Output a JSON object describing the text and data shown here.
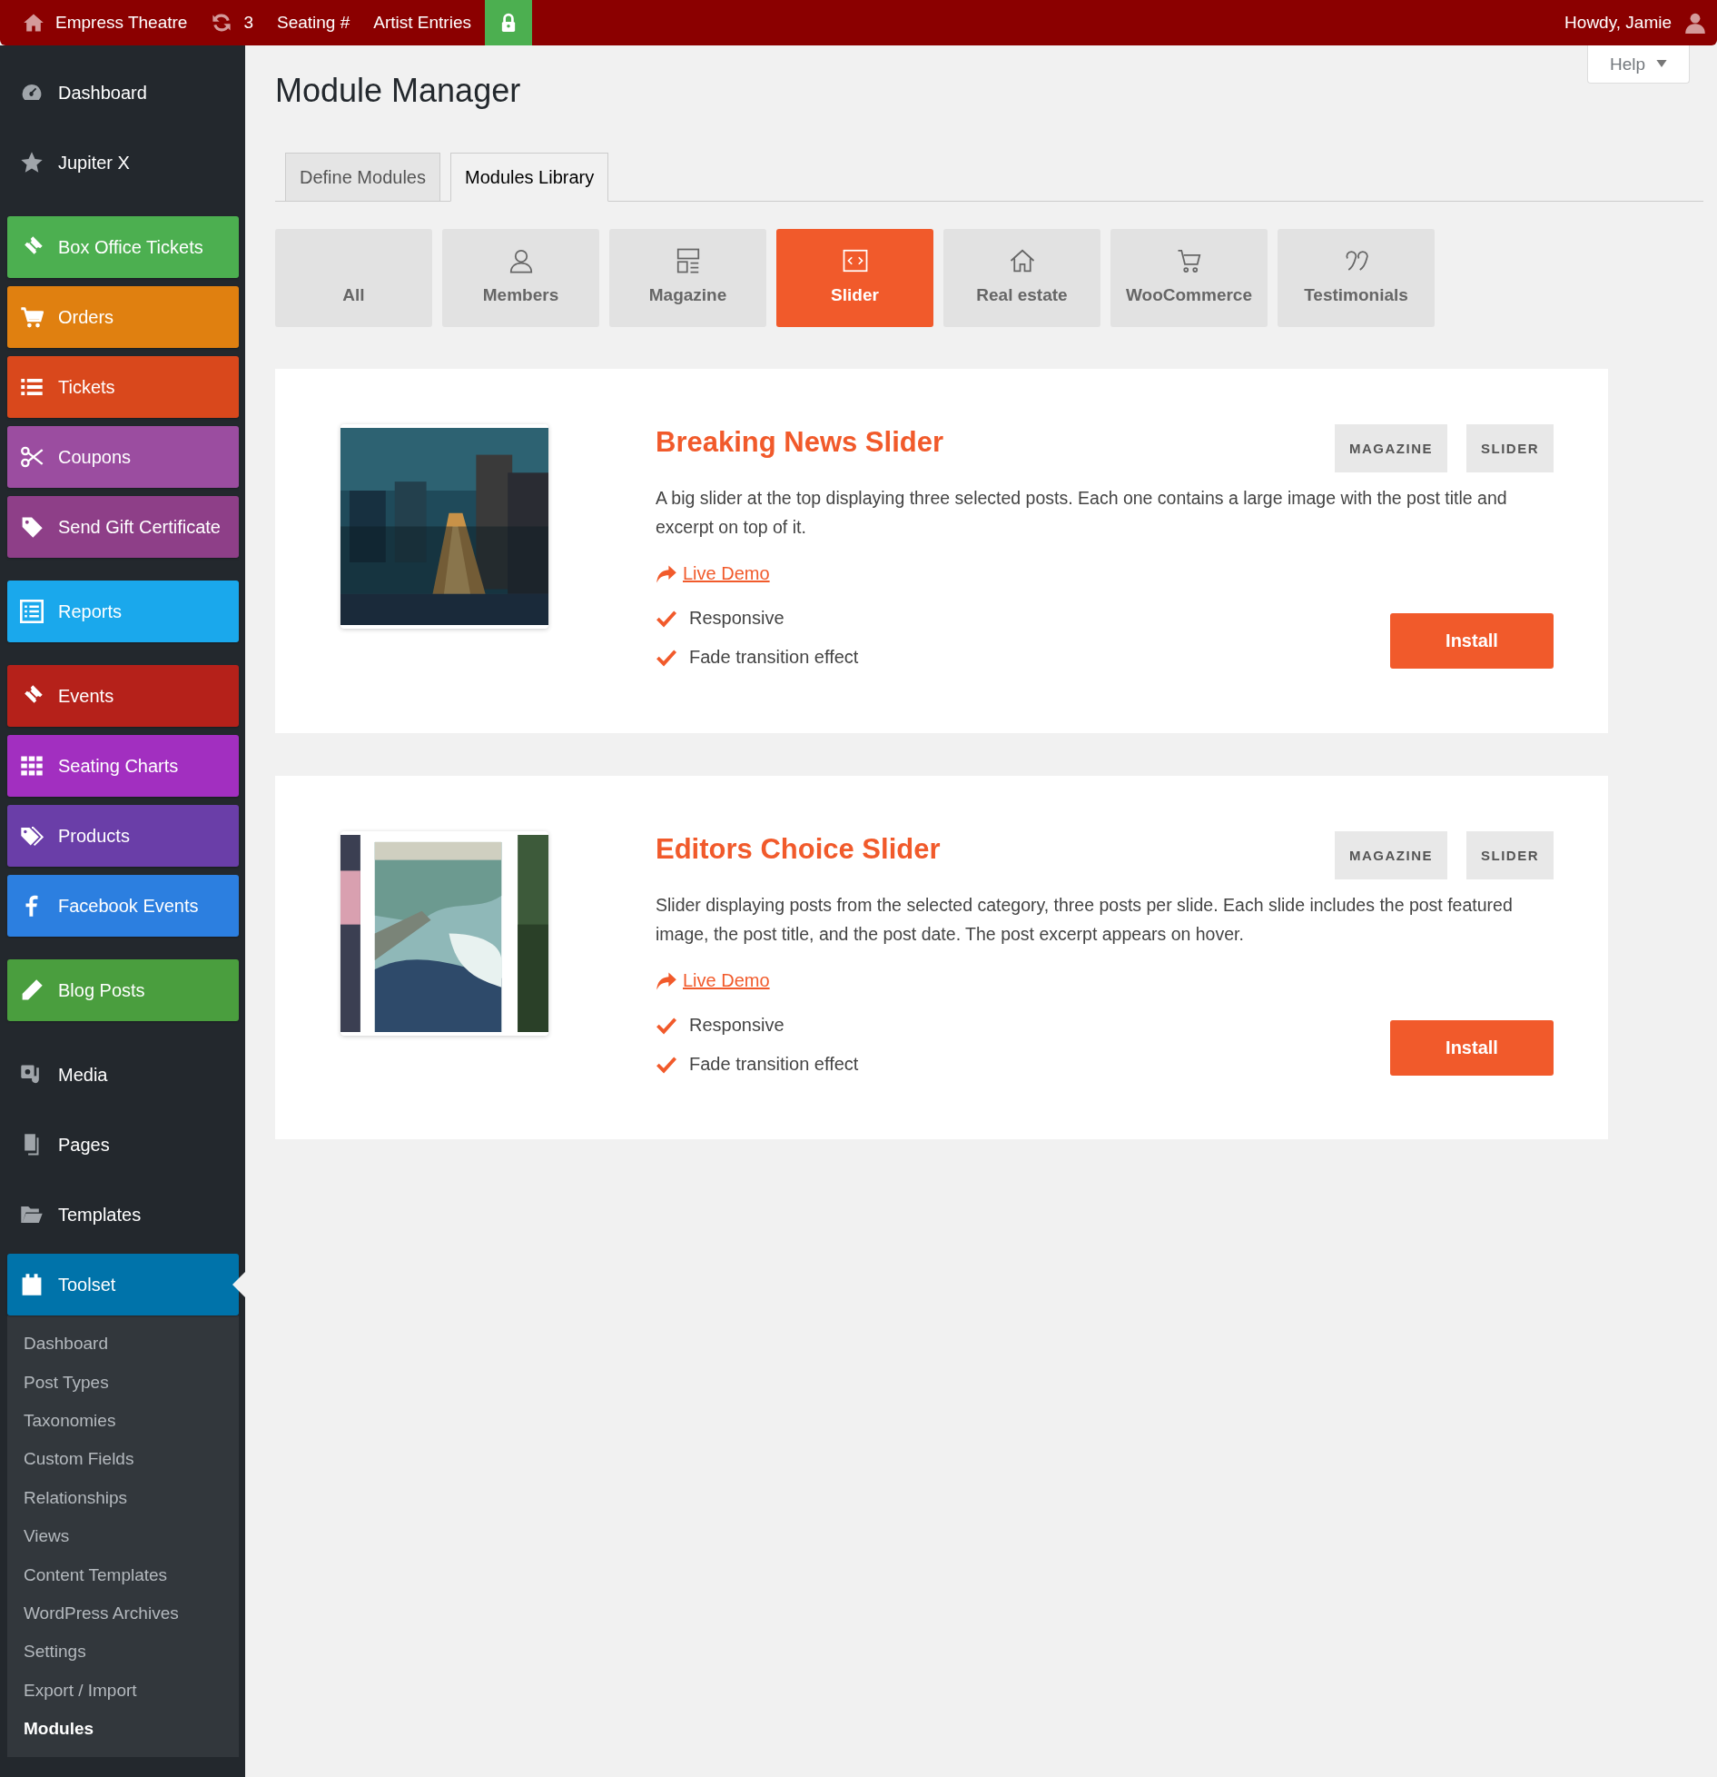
{
  "admin_bar": {
    "items": [
      {
        "kind": "home",
        "label": "Empress Theatre"
      },
      {
        "kind": "updates",
        "label": "3"
      },
      {
        "kind": "text",
        "label": "Seating #"
      },
      {
        "kind": "text",
        "label": "Artist Entries"
      },
      {
        "kind": "lock"
      }
    ],
    "account": "Howdy, Jamie"
  },
  "sidebar": {
    "groups": [
      [
        {
          "label": "Dashboard",
          "selected": false
        },
        {
          "label": "Jupiter X",
          "selected": false
        }
      ],
      [
        {
          "label": "Box Office Tickets",
          "color": "#4caf50",
          "selected": false
        },
        {
          "label": "Orders",
          "color": "#e08010",
          "selected": false
        },
        {
          "label": "Tickets",
          "color": "#d9481c",
          "selected": false
        },
        {
          "label": "Coupons",
          "color": "#9b4da0",
          "selected": false
        },
        {
          "label": "Send Gift Certificate",
          "color": "#8e3f88",
          "selected": false
        }
      ],
      [
        {
          "label": "Reports",
          "color": "#1aa8ec",
          "selected": false
        }
      ],
      [
        {
          "label": "Events",
          "color": "#b5211a",
          "selected": false
        },
        {
          "label": "Seating Charts",
          "color": "#a22fc0",
          "selected": false
        },
        {
          "label": "Products",
          "color": "#6a3ea8",
          "selected": false
        },
        {
          "label": "Facebook Events",
          "color": "#2c7fe0",
          "selected": false
        }
      ],
      [
        {
          "label": "Blog Posts",
          "color": "#4a9e3e",
          "selected": false
        }
      ],
      [
        {
          "label": "Media",
          "selected": false
        },
        {
          "label": "Pages",
          "selected": false
        },
        {
          "label": "Templates",
          "selected": false
        },
        {
          "label": "Toolset",
          "color": "#0073aa",
          "selected": true,
          "children": [
            {
              "label": "Dashboard",
              "selected": false
            },
            {
              "label": "Post Types",
              "selected": false
            },
            {
              "label": "Taxonomies",
              "selected": false
            },
            {
              "label": "Custom Fields",
              "selected": false
            },
            {
              "label": "Relationships",
              "selected": false
            },
            {
              "label": "Views",
              "selected": false
            },
            {
              "label": "Content Templates",
              "selected": false
            },
            {
              "label": "WordPress Archives",
              "selected": false
            },
            {
              "label": "Settings",
              "selected": false
            },
            {
              "label": "Export / Import",
              "selected": false
            },
            {
              "label": "Modules",
              "selected": true
            }
          ]
        }
      ]
    ]
  },
  "help_button": "Help",
  "page_title": "Module Manager",
  "tabs": [
    {
      "label": "Define Modules",
      "selected": false
    },
    {
      "label": "Modules Library",
      "selected": true
    }
  ],
  "filters": [
    {
      "label": "All",
      "selected": false
    },
    {
      "label": "Members",
      "selected": false
    },
    {
      "label": "Magazine",
      "selected": false
    },
    {
      "label": "Slider",
      "selected": true
    },
    {
      "label": "Real estate",
      "selected": false
    },
    {
      "label": "WooCommerce",
      "selected": false
    },
    {
      "label": "Testimonials",
      "selected": false
    }
  ],
  "modules": [
    {
      "title": "Breaking News Slider",
      "tags": [
        "MAGAZINE",
        "SLIDER"
      ],
      "description": "A big slider at the top displaying three selected posts. Each one contains a large image with the post title and excerpt on top of it.",
      "demo_link": "Live Demo",
      "features": [
        "Responsive",
        "Fade transition effect"
      ],
      "button": "Install"
    },
    {
      "title": "Editors Choice Slider",
      "tags": [
        "MAGAZINE",
        "SLIDER"
      ],
      "description": "Slider displaying posts from the selected category, three posts per slide. Each slide includes the post featured image, the post title, and the post date. The post excerpt appears on hover.",
      "demo_link": "Live Demo",
      "features": [
        "Responsive",
        "Fade transition effect"
      ],
      "button": "Install"
    }
  ]
}
